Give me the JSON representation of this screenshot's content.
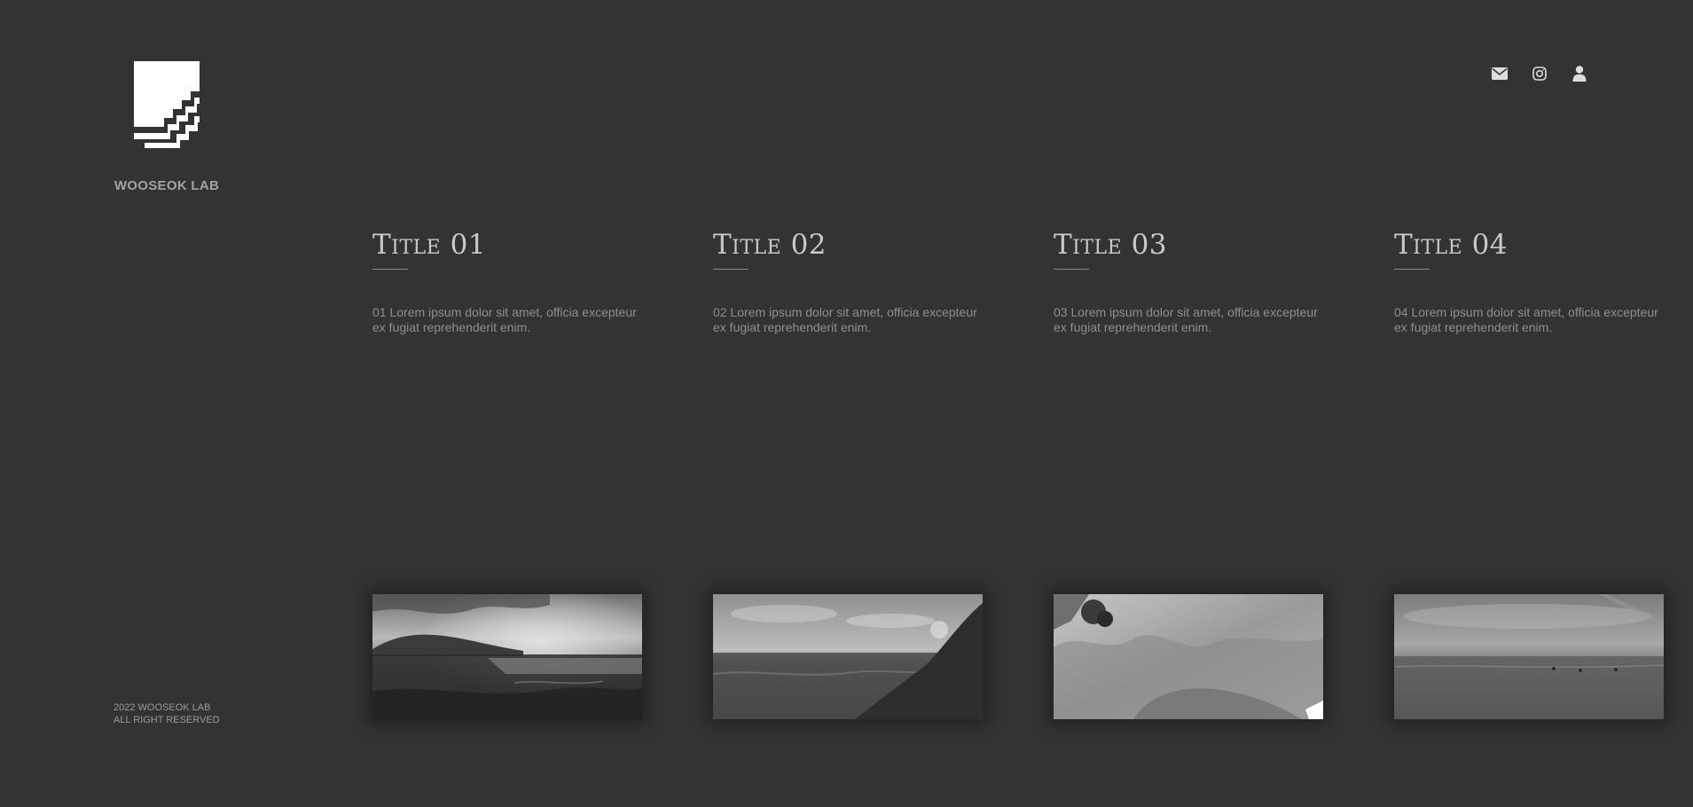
{
  "brand": {
    "name": "WOOSEOK LAB",
    "logo_icon": "stairs-logo-icon"
  },
  "header_icons": [
    {
      "name": "mail-icon"
    },
    {
      "name": "instagram-icon"
    },
    {
      "name": "user-icon"
    }
  ],
  "columns": [
    {
      "title": "Title 01",
      "text": "01 Lorem ipsum dolor sit amet, officia excepteur ex fugiat reprehenderit enim.",
      "image": "ocean-sunset-island"
    },
    {
      "title": "Title 02",
      "text": "02 Lorem ipsum dolor sit amet, officia excepteur ex fugiat reprehenderit enim.",
      "image": "ocean-rocky-shore"
    },
    {
      "title": "Title 03",
      "text": "03 Lorem ipsum dolor sit amet, officia excepteur ex fugiat reprehenderit enim.",
      "image": "closeup-sea-foam"
    },
    {
      "title": "Title 04",
      "text": "04 Lorem ipsum dolor sit amet, officia excepteur ex fugiat reprehenderit enim.",
      "image": "calm-sea-horizon"
    }
  ],
  "footer": {
    "line1": "2022 WOOSEOK LAB",
    "line2": "ALL RIGHT RESERVED"
  },
  "colors": {
    "background": "#333333",
    "title": "#c9c9c9",
    "body_text": "#8e8e8e",
    "logo": "#ffffff"
  }
}
